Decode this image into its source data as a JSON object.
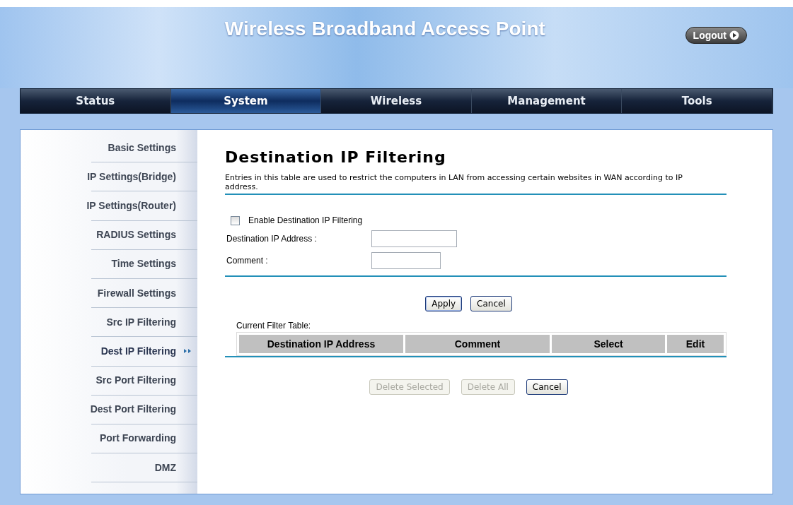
{
  "header": {
    "title": "Wireless Broadband Access Point",
    "logout": "Logout"
  },
  "nav": [
    {
      "label": "Status",
      "selected": false
    },
    {
      "label": "System",
      "selected": true
    },
    {
      "label": "Wireless",
      "selected": false
    },
    {
      "label": "Management",
      "selected": false
    },
    {
      "label": "Tools",
      "selected": false
    }
  ],
  "sidebar": {
    "items": [
      {
        "label": "Basic Settings",
        "selected": false
      },
      {
        "label": "IP Settings(Bridge)",
        "selected": false
      },
      {
        "label": "IP Settings(Router)",
        "selected": false
      },
      {
        "label": "RADIUS Settings",
        "selected": false
      },
      {
        "label": "Time Settings",
        "selected": false
      },
      {
        "label": "Firewall Settings",
        "selected": false
      },
      {
        "label": "Src IP Filtering",
        "selected": false
      },
      {
        "label": "Dest IP Filtering",
        "selected": true
      },
      {
        "label": "Src Port Filtering",
        "selected": false
      },
      {
        "label": "Dest Port Filtering",
        "selected": false
      },
      {
        "label": "Port Forwarding",
        "selected": false
      },
      {
        "label": "DMZ",
        "selected": false
      }
    ]
  },
  "content": {
    "title": "Destination IP Filtering",
    "description": "Entries in this table are used to restrict the computers in LAN from accessing certain websites in WAN according to IP address.",
    "enable": {
      "label": "Enable Destination IP Filtering",
      "checked": false
    },
    "fields": [
      {
        "label": "Destination IP Address :"
      },
      {
        "label": "Comment :"
      }
    ],
    "form_buttons": [
      {
        "label": "Apply",
        "disabled": false
      },
      {
        "label": "Cancel",
        "disabled": false
      }
    ],
    "table": {
      "caption": "Current Filter Table:",
      "columns": [
        "Destination IP Address",
        "Comment",
        "Select",
        "Edit"
      ]
    },
    "table_buttons": [
      {
        "label": "Delete Selected",
        "disabled": true
      },
      {
        "label": "Delete All",
        "disabled": true
      },
      {
        "label": "Cancel",
        "disabled": false
      }
    ]
  }
}
